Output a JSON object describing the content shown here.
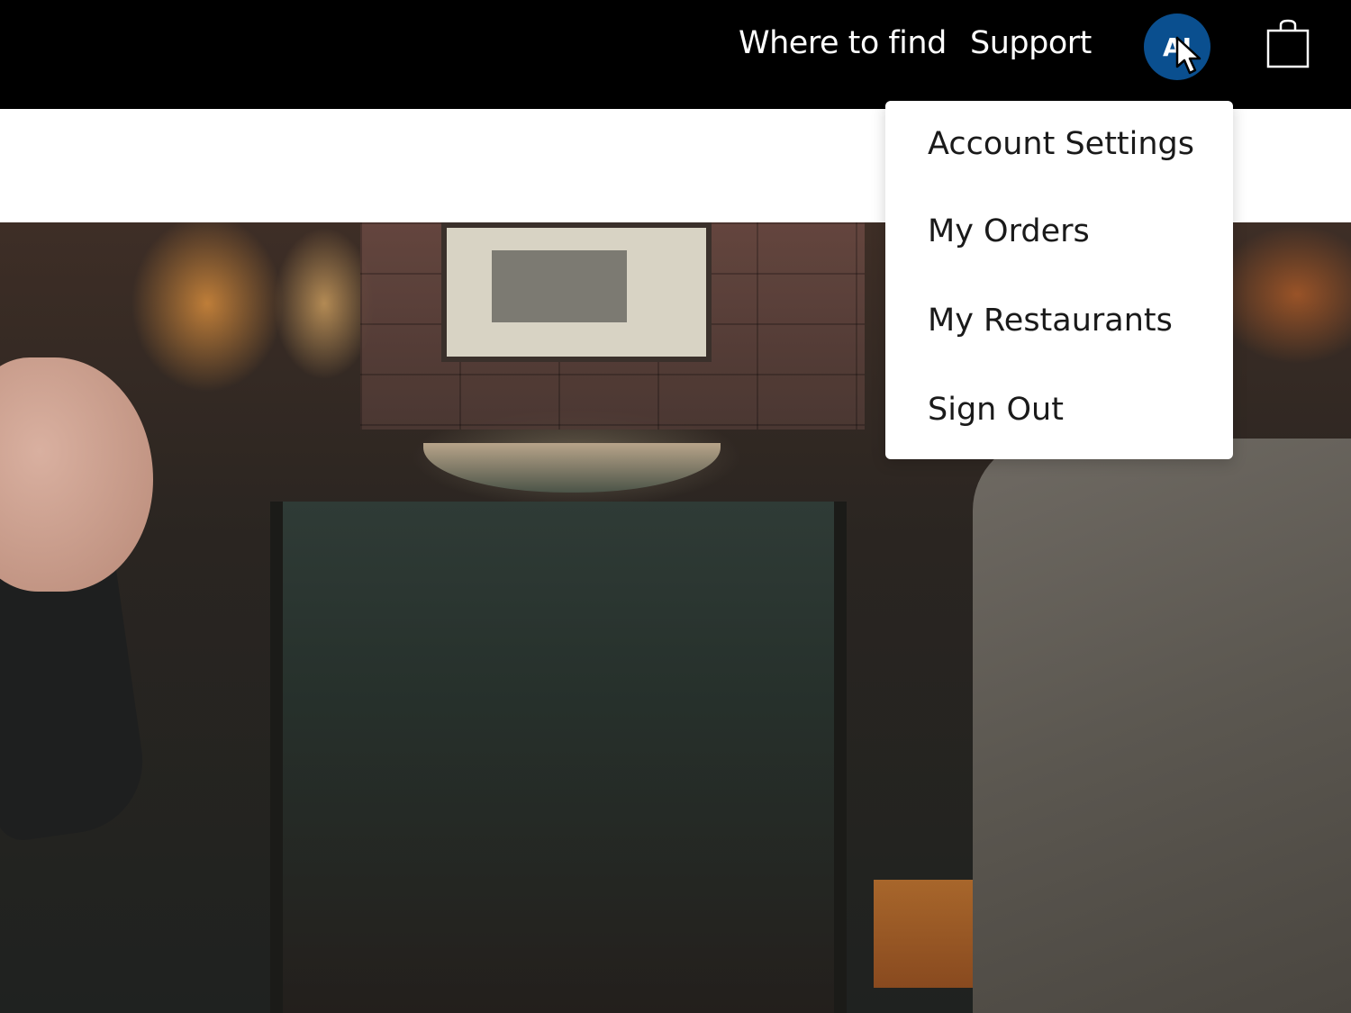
{
  "header": {
    "nav": [
      {
        "label": "Where to find"
      },
      {
        "label": "Support"
      }
    ],
    "avatar": {
      "initials": "AI",
      "background": "#0a4f8f"
    },
    "cart": {
      "icon": "shopping-bag-icon"
    }
  },
  "account_menu": {
    "items": [
      {
        "label": "Account Settings"
      },
      {
        "label": "My Orders"
      },
      {
        "label": "My Restaurants"
      },
      {
        "label": "Sign Out"
      }
    ]
  },
  "colors": {
    "topbar": "#000000",
    "menu_text": "#1a1a1a",
    "avatar": "#0a4f8f"
  }
}
